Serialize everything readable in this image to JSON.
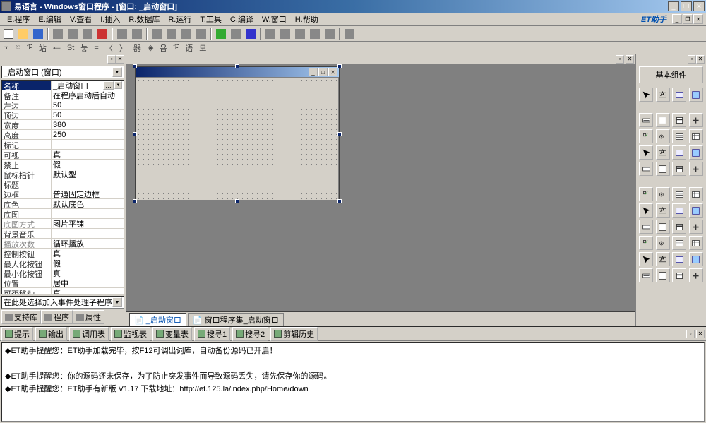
{
  "title": "易语言 - Windows窗口程序 - [窗口: _启动窗口]",
  "menus": [
    "E.程序",
    "E.编辑",
    "V.查看",
    "I.插入",
    "R.数据库",
    "R.运行",
    "T.工具",
    "C.编译",
    "W.窗口",
    "H.帮助"
  ],
  "et_brand": "ET助手",
  "toolbar2": [
    "⫟",
    "ಬ",
    "ፑ",
    "站",
    "⏛",
    "St",
    "놓",
    "=",
    "〈",
    "〉",
    "器",
    "◈",
    "욤",
    "ፑ",
    "语",
    "모"
  ],
  "left_combo": "_启动窗口 (窗口)",
  "props": [
    {
      "k": "名称",
      "v": "_启动窗口",
      "mode": "sel"
    },
    {
      "k": "备注",
      "v": "在程序启动后自动"
    },
    {
      "k": "左边",
      "v": "50"
    },
    {
      "k": "顶边",
      "v": "50"
    },
    {
      "k": "宽度",
      "v": "380"
    },
    {
      "k": "高度",
      "v": "250"
    },
    {
      "k": "标记",
      "v": ""
    },
    {
      "k": "可视",
      "v": "真"
    },
    {
      "k": "禁止",
      "v": "假"
    },
    {
      "k": "鼠标指针",
      "v": "默认型"
    },
    {
      "k": "标题",
      "v": ""
    },
    {
      "k": "边框",
      "v": "普通固定边框"
    },
    {
      "k": "底色",
      "v": "默认底色"
    },
    {
      "k": "底图",
      "v": ""
    },
    {
      "k": "底图方式",
      "v": "图片平铺",
      "gray": true
    },
    {
      "k": "背景音乐",
      "v": ""
    },
    {
      "k": "播放次数",
      "v": "循环播放",
      "gray": true
    },
    {
      "k": "控制按钮",
      "v": "真"
    },
    {
      "k": "最大化按钮",
      "v": "假"
    },
    {
      "k": "最小化按钮",
      "v": "真"
    },
    {
      "k": "位置",
      "v": "居中"
    },
    {
      "k": "可否移动",
      "v": "真"
    }
  ],
  "help_text": "在此处选择加入事件处理子程序",
  "left_tabs": [
    "支持库",
    "程序",
    "属性"
  ],
  "center_tabs": [
    "_启动窗口",
    "窗口程序集_启动窗口"
  ],
  "right_title": "基本组件",
  "bottom_tabs": [
    "提示",
    "输出",
    "调用表",
    "监视表",
    "变量表",
    "搜寻1",
    "搜寻2",
    "剪辑历史"
  ],
  "bottom_tabs_icons": [
    "?",
    "",
    "",
    "",
    "",
    "",
    "",
    ""
  ],
  "bottom_messages": [
    "◆ET助手提醒您：ET助手加载完毕，按F12可调出词库，自动备份源码已开启！",
    "",
    "◆ET助手提醒您：你的源码还未保存，为了防止突发事件而导致源码丢失，请先保存你的源码。",
    "◆ET助手提醒您：ET助手有新版 V1.17  下载地址：http://et.125.la/index.php/Home/down"
  ]
}
